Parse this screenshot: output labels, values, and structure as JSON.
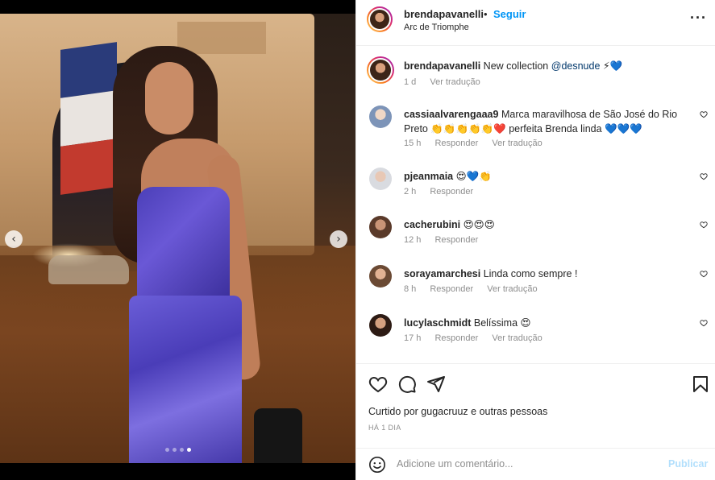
{
  "post": {
    "carousel": {
      "slide_count": 4,
      "active_slide": 4
    },
    "header": {
      "username": "brendapavanelli",
      "separator": "•",
      "follow_label": "Seguir",
      "location": "Arc de Triomphe",
      "more_label": "···"
    },
    "caption": {
      "username": "brendapavanelli",
      "text": "New collection",
      "mention": "@desnude",
      "emojis": "⚡💙",
      "time": "1 d",
      "translate": "Ver tradução"
    },
    "comments": [
      {
        "username": "cassiaalvarengaaa9",
        "text": "Marca maravilhosa de São José do Rio Preto 👏👏👏👏👏❤️ perfeita Brenda linda 💙💙💙",
        "time": "15 h",
        "reply": "Responder",
        "translate": "Ver tradução"
      },
      {
        "username": "pjeanmaia",
        "text": "😍💙👏",
        "time": "2 h",
        "reply": "Responder",
        "translate": ""
      },
      {
        "username": "cacherubini",
        "text": "😍😍😍",
        "time": "12 h",
        "reply": "Responder",
        "translate": ""
      },
      {
        "username": "sorayamarchesi",
        "text": "Linda como sempre !",
        "time": "8 h",
        "reply": "Responder",
        "translate": "Ver tradução"
      },
      {
        "username": "lucylaschmidt",
        "text": "Belíssima 😍",
        "time": "17 h",
        "reply": "Responder",
        "translate": "Ver tradução"
      }
    ],
    "likes_text": "Curtido por gugacruuz e outras pessoas",
    "time_ago": "HÁ 1 DIA",
    "add_comment_placeholder": "Adicione um comentário...",
    "publish_label": "Publicar"
  },
  "colors": {
    "accent": "#0095f6",
    "publish_disabled": "#b2dffc",
    "mention": "#00376b",
    "meta": "#8e8e8e"
  }
}
